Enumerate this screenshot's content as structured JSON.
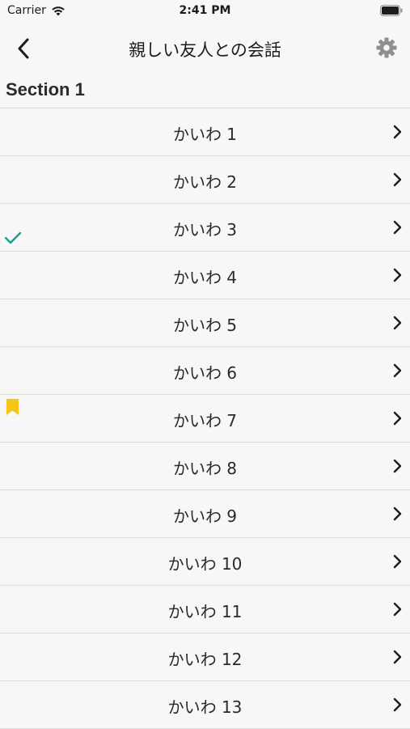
{
  "status_bar": {
    "carrier": "Carrier",
    "time": "2:41 PM",
    "wifi_icon": "wifi-icon",
    "battery_icon": "battery-icon"
  },
  "nav": {
    "title": "親しい友人との会話",
    "back_icon": "chevron-left-icon",
    "settings_icon": "gear-icon"
  },
  "section": {
    "title": "Section 1"
  },
  "rows": [
    {
      "label": "かいわ 1",
      "marker": "none"
    },
    {
      "label": "かいわ 2",
      "marker": "none"
    },
    {
      "label": "かいわ 3",
      "marker": "checkmark"
    },
    {
      "label": "かいわ 4",
      "marker": "none"
    },
    {
      "label": "かいわ 5",
      "marker": "none"
    },
    {
      "label": "かいわ 6",
      "marker": "none"
    },
    {
      "label": "かいわ 7",
      "marker": "bookmark"
    },
    {
      "label": "かいわ 8",
      "marker": "none"
    },
    {
      "label": "かいわ 9",
      "marker": "none"
    },
    {
      "label": "かいわ 10",
      "marker": "none"
    },
    {
      "label": "かいわ 11",
      "marker": "none"
    },
    {
      "label": "かいわ 12",
      "marker": "none"
    },
    {
      "label": "かいわ 13",
      "marker": "none"
    }
  ],
  "colors": {
    "checkmark": "#1a9e8f",
    "bookmark": "#f5c518",
    "gear": "#8e8e93",
    "chevron": "#1c1c1e"
  }
}
